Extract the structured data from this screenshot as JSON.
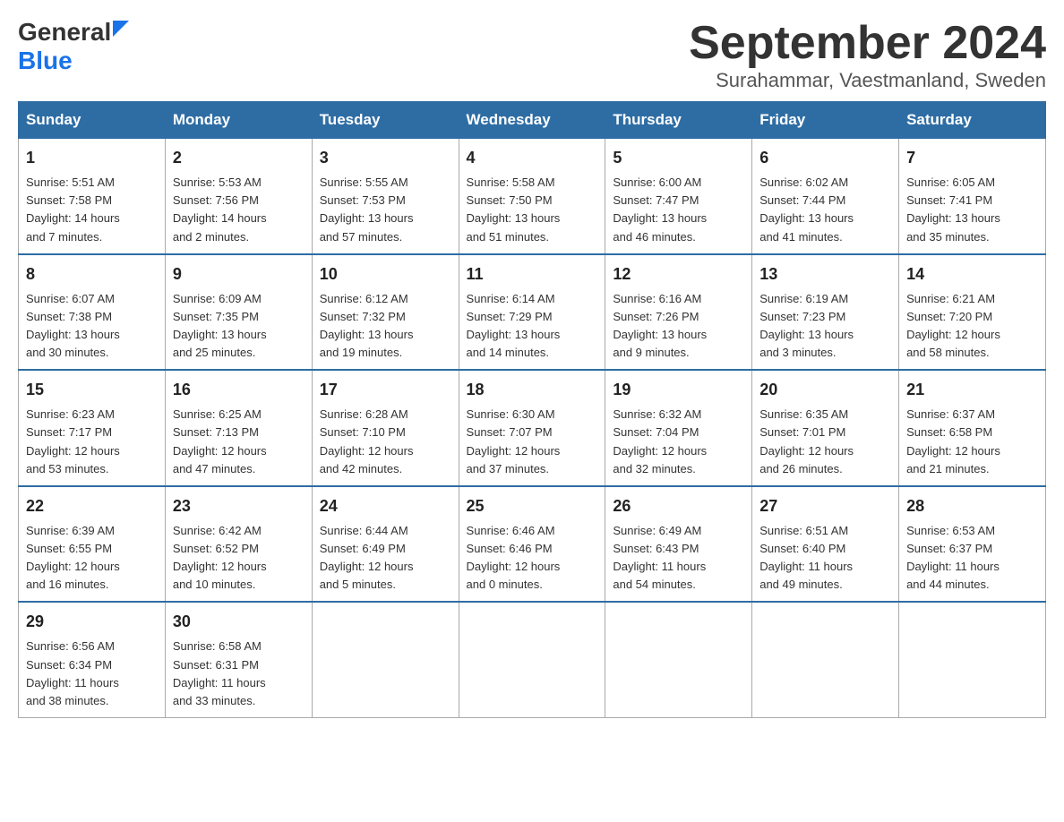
{
  "header": {
    "logo": {
      "general": "General",
      "blue": "Blue",
      "line2": "Blue"
    },
    "title": "September 2024",
    "location": "Surahammar, Vaestmanland, Sweden"
  },
  "columns": [
    "Sunday",
    "Monday",
    "Tuesday",
    "Wednesday",
    "Thursday",
    "Friday",
    "Saturday"
  ],
  "weeks": [
    [
      {
        "day": "1",
        "sunrise": "5:51 AM",
        "sunset": "7:58 PM",
        "daylight": "14 hours and 7 minutes."
      },
      {
        "day": "2",
        "sunrise": "5:53 AM",
        "sunset": "7:56 PM",
        "daylight": "14 hours and 2 minutes."
      },
      {
        "day": "3",
        "sunrise": "5:55 AM",
        "sunset": "7:53 PM",
        "daylight": "13 hours and 57 minutes."
      },
      {
        "day": "4",
        "sunrise": "5:58 AM",
        "sunset": "7:50 PM",
        "daylight": "13 hours and 51 minutes."
      },
      {
        "day": "5",
        "sunrise": "6:00 AM",
        "sunset": "7:47 PM",
        "daylight": "13 hours and 46 minutes."
      },
      {
        "day": "6",
        "sunrise": "6:02 AM",
        "sunset": "7:44 PM",
        "daylight": "13 hours and 41 minutes."
      },
      {
        "day": "7",
        "sunrise": "6:05 AM",
        "sunset": "7:41 PM",
        "daylight": "13 hours and 35 minutes."
      }
    ],
    [
      {
        "day": "8",
        "sunrise": "6:07 AM",
        "sunset": "7:38 PM",
        "daylight": "13 hours and 30 minutes."
      },
      {
        "day": "9",
        "sunrise": "6:09 AM",
        "sunset": "7:35 PM",
        "daylight": "13 hours and 25 minutes."
      },
      {
        "day": "10",
        "sunrise": "6:12 AM",
        "sunset": "7:32 PM",
        "daylight": "13 hours and 19 minutes."
      },
      {
        "day": "11",
        "sunrise": "6:14 AM",
        "sunset": "7:29 PM",
        "daylight": "13 hours and 14 minutes."
      },
      {
        "day": "12",
        "sunrise": "6:16 AM",
        "sunset": "7:26 PM",
        "daylight": "13 hours and 9 minutes."
      },
      {
        "day": "13",
        "sunrise": "6:19 AM",
        "sunset": "7:23 PM",
        "daylight": "13 hours and 3 minutes."
      },
      {
        "day": "14",
        "sunrise": "6:21 AM",
        "sunset": "7:20 PM",
        "daylight": "12 hours and 58 minutes."
      }
    ],
    [
      {
        "day": "15",
        "sunrise": "6:23 AM",
        "sunset": "7:17 PM",
        "daylight": "12 hours and 53 minutes."
      },
      {
        "day": "16",
        "sunrise": "6:25 AM",
        "sunset": "7:13 PM",
        "daylight": "12 hours and 47 minutes."
      },
      {
        "day": "17",
        "sunrise": "6:28 AM",
        "sunset": "7:10 PM",
        "daylight": "12 hours and 42 minutes."
      },
      {
        "day": "18",
        "sunrise": "6:30 AM",
        "sunset": "7:07 PM",
        "daylight": "12 hours and 37 minutes."
      },
      {
        "day": "19",
        "sunrise": "6:32 AM",
        "sunset": "7:04 PM",
        "daylight": "12 hours and 32 minutes."
      },
      {
        "day": "20",
        "sunrise": "6:35 AM",
        "sunset": "7:01 PM",
        "daylight": "12 hours and 26 minutes."
      },
      {
        "day": "21",
        "sunrise": "6:37 AM",
        "sunset": "6:58 PM",
        "daylight": "12 hours and 21 minutes."
      }
    ],
    [
      {
        "day": "22",
        "sunrise": "6:39 AM",
        "sunset": "6:55 PM",
        "daylight": "12 hours and 16 minutes."
      },
      {
        "day": "23",
        "sunrise": "6:42 AM",
        "sunset": "6:52 PM",
        "daylight": "12 hours and 10 minutes."
      },
      {
        "day": "24",
        "sunrise": "6:44 AM",
        "sunset": "6:49 PM",
        "daylight": "12 hours and 5 minutes."
      },
      {
        "day": "25",
        "sunrise": "6:46 AM",
        "sunset": "6:46 PM",
        "daylight": "12 hours and 0 minutes."
      },
      {
        "day": "26",
        "sunrise": "6:49 AM",
        "sunset": "6:43 PM",
        "daylight": "11 hours and 54 minutes."
      },
      {
        "day": "27",
        "sunrise": "6:51 AM",
        "sunset": "6:40 PM",
        "daylight": "11 hours and 49 minutes."
      },
      {
        "day": "28",
        "sunrise": "6:53 AM",
        "sunset": "6:37 PM",
        "daylight": "11 hours and 44 minutes."
      }
    ],
    [
      {
        "day": "29",
        "sunrise": "6:56 AM",
        "sunset": "6:34 PM",
        "daylight": "11 hours and 38 minutes."
      },
      {
        "day": "30",
        "sunrise": "6:58 AM",
        "sunset": "6:31 PM",
        "daylight": "11 hours and 33 minutes."
      },
      null,
      null,
      null,
      null,
      null
    ]
  ]
}
